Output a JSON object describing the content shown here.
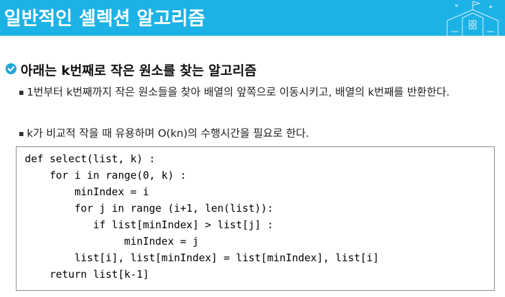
{
  "header": {
    "title": "일반적인 셀렉션 알고리즘",
    "bg_color": "#1cb2e6",
    "deco_icon": "school-building-icon"
  },
  "section": {
    "icon": "check-circle-icon",
    "subtitle": "아래는 k번째로 작은 원소를 찾는 알고리즘"
  },
  "bullets": [
    "1번부터 k번째까지 작은 원소들을 찾아 배열의 앞쪽으로 이동시키고, 배열의 k번째를 반환한다.",
    "k가 비교적 작을 때 유용하며 O(kn)의 수행시간을 필요로 한다."
  ],
  "code": {
    "lines": [
      "def select(list, k) :",
      "    for i in range(0, k) :",
      "        minIndex = i",
      "        for j in range (i+1, len(list)):",
      "           if list[minIndex] > list[j] :",
      "                minIndex = j",
      "        list[i], list[minIndex] = list[minIndex], list[i]",
      "    return list[k-1]"
    ]
  }
}
